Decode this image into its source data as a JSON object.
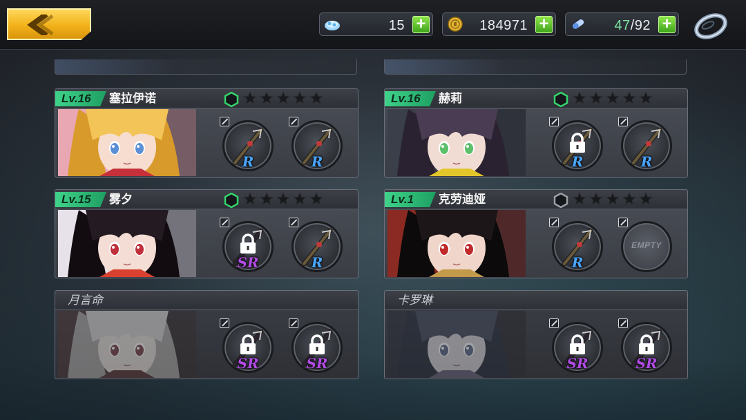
{
  "topbar": {
    "back_icon": "chevron-left-icon",
    "crystals": {
      "icon": "crystal-icon",
      "value": "15"
    },
    "gold": {
      "icon": "gold-coin-icon",
      "value": "184971"
    },
    "stamina": {
      "icon": "potion-icon",
      "current": "47",
      "separator": "/",
      "max": "92"
    },
    "plus_label": "+",
    "settings_icon": "ring-icon"
  },
  "colors": {
    "level_badge": "#2fbf78",
    "rarity_R": "#4aa6ff",
    "rarity_SR": "#b24be6",
    "plus_button": "#5ccb2c",
    "back_button": "#f2b21a"
  },
  "characters": [
    {
      "level": "Lv.16",
      "name": "塞拉伊诺",
      "stars": 5,
      "rank_active": true,
      "locked": false,
      "slots": [
        {
          "rarity": "R",
          "locked": false,
          "weapon_icon": "golden-trident-icon"
        },
        {
          "rarity": "R",
          "locked": false,
          "weapon_icon": "red-whip-icon"
        }
      ]
    },
    {
      "level": "Lv.16",
      "name": "赫莉",
      "stars": 5,
      "rank_active": true,
      "locked": false,
      "slots": [
        {
          "rarity": "R",
          "locked": true,
          "weapon_icon": "dark-gun-icon"
        },
        {
          "rarity": "R",
          "locked": false,
          "weapon_icon": "rifle-icon"
        }
      ]
    },
    {
      "level": "Lv.15",
      "name": "雾夕",
      "stars": 5,
      "rank_active": true,
      "locked": false,
      "slots": [
        {
          "rarity": "SR",
          "locked": true,
          "weapon_icon": "fan-icon"
        },
        {
          "rarity": "R",
          "locked": false,
          "weapon_icon": "chain-blade-icon"
        }
      ]
    },
    {
      "level": "Lv.1",
      "name": "克劳迪娅",
      "stars": 5,
      "rank_active": false,
      "locked": false,
      "slots": [
        {
          "rarity": "R",
          "locked": false,
          "weapon_icon": "rose-staff-icon"
        },
        {
          "empty": true,
          "label": "EMPTY"
        }
      ]
    },
    {
      "level": "",
      "name": "月言命",
      "stars": 0,
      "rank_active": false,
      "locked": true,
      "slots": [
        {
          "rarity": "SR",
          "locked": true,
          "weapon_icon": "dark-blade-icon"
        },
        {
          "rarity": "SR",
          "locked": true,
          "weapon_icon": "dark-sword-icon"
        }
      ]
    },
    {
      "level": "",
      "name": "卡罗琳",
      "stars": 0,
      "rank_active": false,
      "locked": true,
      "slots": [
        {
          "rarity": "SR",
          "locked": true,
          "weapon_icon": "shadow-gun-icon"
        },
        {
          "rarity": "SR",
          "locked": true,
          "weapon_icon": "claw-icon"
        }
      ]
    }
  ]
}
